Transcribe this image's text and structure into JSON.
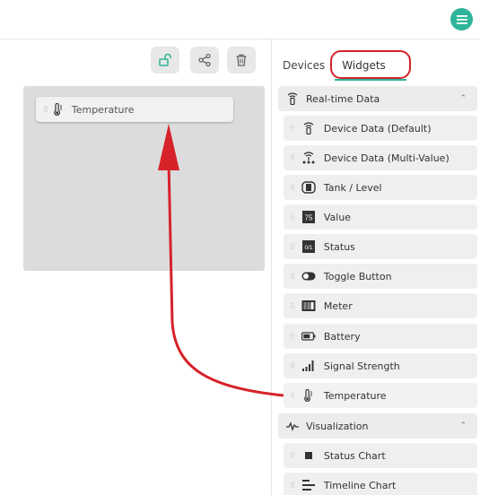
{
  "tabs": {
    "devices": "Devices",
    "widgets": "Widgets"
  },
  "canvas": {
    "widget_label": "Temperature"
  },
  "sections": {
    "realtime": "Real-time Data",
    "visualization": "Visualization"
  },
  "realtime_items": [
    "Device Data (Default)",
    "Device Data (Multi-Value)",
    "Tank / Level",
    "Value",
    "Status",
    "Toggle Button",
    "Meter",
    "Battery",
    "Signal Strength",
    "Temperature"
  ],
  "visualization_items": [
    "Status Chart",
    "Timeline Chart"
  ],
  "colors": {
    "accent": "#2fb59a",
    "annotation": "#d7222a"
  }
}
